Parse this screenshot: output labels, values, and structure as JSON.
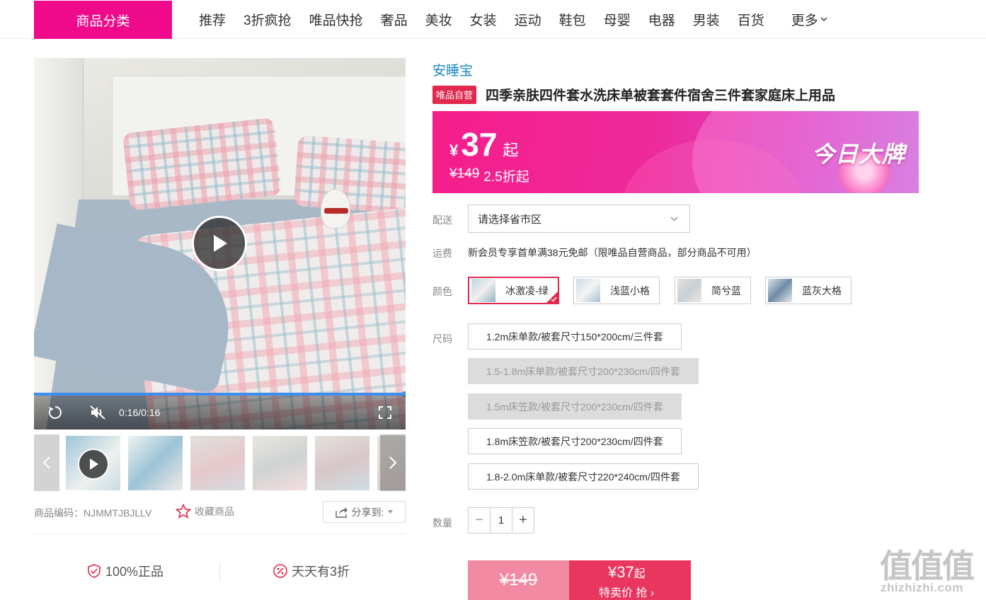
{
  "nav": {
    "category_label": "商品分类",
    "items": [
      "推荐",
      "3折疯抢",
      "唯品快抢",
      "奢品",
      "美妆",
      "女装",
      "运动",
      "鞋包",
      "母婴",
      "电器",
      "男装",
      "百货"
    ],
    "more_label": "更多"
  },
  "video": {
    "time": "0:16/0:16",
    "progress": 1.0
  },
  "meta": {
    "code": "商品编码：NJMMTJBJLLV",
    "fav_label": "收藏商品",
    "share_label": "分享到:"
  },
  "assurances": [
    "100%正品",
    "天天有3折"
  ],
  "product": {
    "brand": "安睡宝",
    "self_tag": "唯品自营",
    "title": "四季亲肤四件套水洗床单被套套件宿舍三件套家庭床上用品"
  },
  "price": {
    "yen": "¥",
    "amount": "37",
    "suffix": "起",
    "original": "¥149",
    "discount": "2.5折起",
    "badge": "今日大牌"
  },
  "delivery": {
    "label": "配送",
    "placeholder": "请选择省市区"
  },
  "shipping": {
    "label": "运费",
    "text": "新会员专享首单满38元免邮（限唯品自营商品，部分商品不可用）"
  },
  "colors": {
    "label": "颜色",
    "options": [
      "冰激凌-绿",
      "浅蓝小格",
      "简兮蓝",
      "蓝灰大格"
    ],
    "selected": "冰激凌-绿"
  },
  "sizes": {
    "label": "尺码",
    "options": [
      {
        "text": "1.2m床单款/被套尺寸150*200cm/三件套",
        "available": true
      },
      {
        "text": "1.5-1.8m床单款/被套尺寸200*230cm/四件套",
        "available": false
      },
      {
        "text": "1.5m床笠款/被套尺寸200*230cm/四件套",
        "available": false
      },
      {
        "text": "1.8m床笠款/被套尺寸200*230cm/四件套",
        "available": true
      },
      {
        "text": "1.8-2.0m床单款/被套尺寸220*240cm/四件套",
        "available": true
      }
    ]
  },
  "quantity": {
    "label": "数量",
    "minus": "−",
    "value": "1",
    "plus": "+"
  },
  "buy": {
    "original": "¥149",
    "price": "¥37",
    "price_suffix": "起",
    "action": "特卖价 抢 ›"
  },
  "watermark": {
    "glyph": "值值值",
    "url": "zhizhizhi.com"
  },
  "colors_theme": {
    "brand_pink": "#ee0a8a",
    "accent_red": "#e3284e",
    "link_blue": "#1a87c9"
  }
}
